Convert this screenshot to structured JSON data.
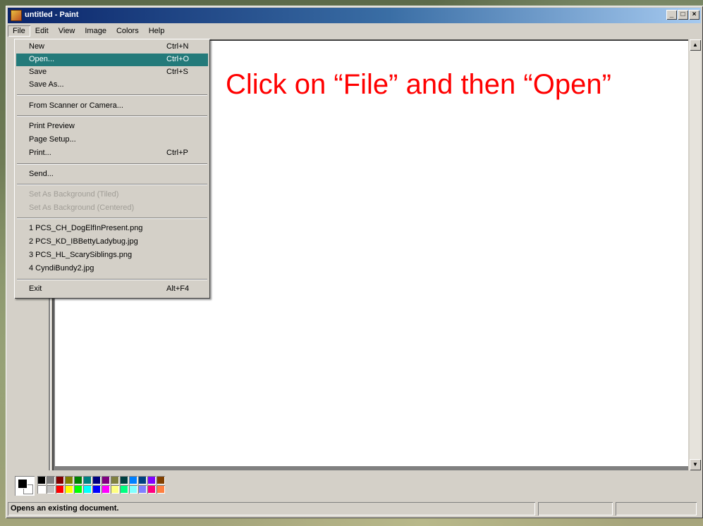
{
  "window": {
    "title": "untitled - Paint"
  },
  "titlebar_buttons": {
    "minimize": "_",
    "maximize": "□",
    "close": "×"
  },
  "menubar": [
    {
      "label": "File"
    },
    {
      "label": "Edit"
    },
    {
      "label": "View"
    },
    {
      "label": "Image"
    },
    {
      "label": "Colors"
    },
    {
      "label": "Help"
    }
  ],
  "file_menu": {
    "items": [
      {
        "label": "New",
        "shortcut": "Ctrl+N"
      },
      {
        "label": "Open...",
        "shortcut": "Ctrl+O",
        "highlighted": true
      },
      {
        "label": "Save",
        "shortcut": "Ctrl+S"
      },
      {
        "label": "Save As...",
        "shortcut": ""
      },
      {
        "label": "From Scanner or Camera...",
        "shortcut": ""
      },
      {
        "label": "Print Preview",
        "shortcut": ""
      },
      {
        "label": "Page Setup...",
        "shortcut": ""
      },
      {
        "label": "Print...",
        "shortcut": "Ctrl+P"
      },
      {
        "label": "Send...",
        "shortcut": ""
      },
      {
        "label": "Set As Background (Tiled)",
        "shortcut": "",
        "disabled": true
      },
      {
        "label": "Set As Background (Centered)",
        "shortcut": "",
        "disabled": true
      },
      {
        "label": "1 PCS_CH_DogElfInPresent.png",
        "shortcut": ""
      },
      {
        "label": "2 PCS_KD_IBBettyLadybug.jpg",
        "shortcut": ""
      },
      {
        "label": "3 PCS_HL_ScarySiblings.png",
        "shortcut": ""
      },
      {
        "label": "4 CyndiBundy2.jpg",
        "shortcut": ""
      },
      {
        "label": "Exit",
        "shortcut": "Alt+F4"
      }
    ]
  },
  "instruction": "Click on “File” and then “Open”",
  "palette": {
    "colors": [
      "#000000",
      "#808080",
      "#800000",
      "#808000",
      "#008000",
      "#008080",
      "#000080",
      "#800080",
      "#808040",
      "#004040",
      "#0080ff",
      "#004080",
      "#8000ff",
      "#804000",
      "#ffffff",
      "#c0c0c0",
      "#ff0000",
      "#ffff00",
      "#00ff00",
      "#00ffff",
      "#0000ff",
      "#ff00ff",
      "#ffff80",
      "#00ff80",
      "#80ffff",
      "#8080ff",
      "#ff0080",
      "#ff8040"
    ]
  },
  "statusbar": {
    "text": "Opens an existing document."
  }
}
